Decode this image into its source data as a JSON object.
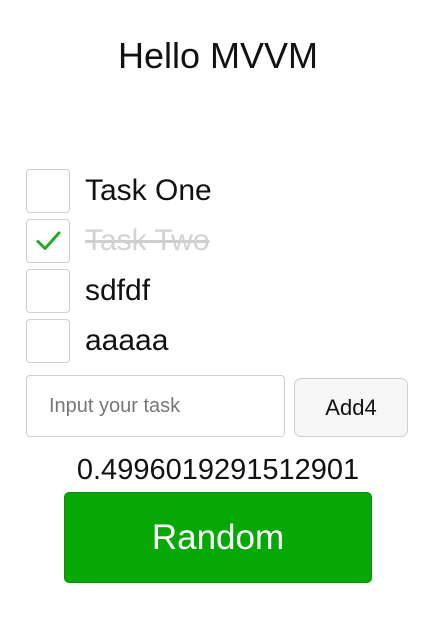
{
  "header": {
    "title": "Hello MVVM"
  },
  "todos": [
    {
      "label": "Task One",
      "done": false
    },
    {
      "label": "Task Two",
      "done": true
    },
    {
      "label": "sdfdf",
      "done": false
    },
    {
      "label": "aaaaa",
      "done": false
    }
  ],
  "form": {
    "input_value": "",
    "input_placeholder": "Input your task",
    "add_button_label": "Add4"
  },
  "random": {
    "value": "0.4996019291512901",
    "button_label": "Random"
  },
  "colors": {
    "check_mark": "#22a822",
    "random_button_bg": "#05a805",
    "done_text": "#d2d2d2",
    "border": "#cfcfcf"
  },
  "icons": {
    "check": "check-icon"
  }
}
